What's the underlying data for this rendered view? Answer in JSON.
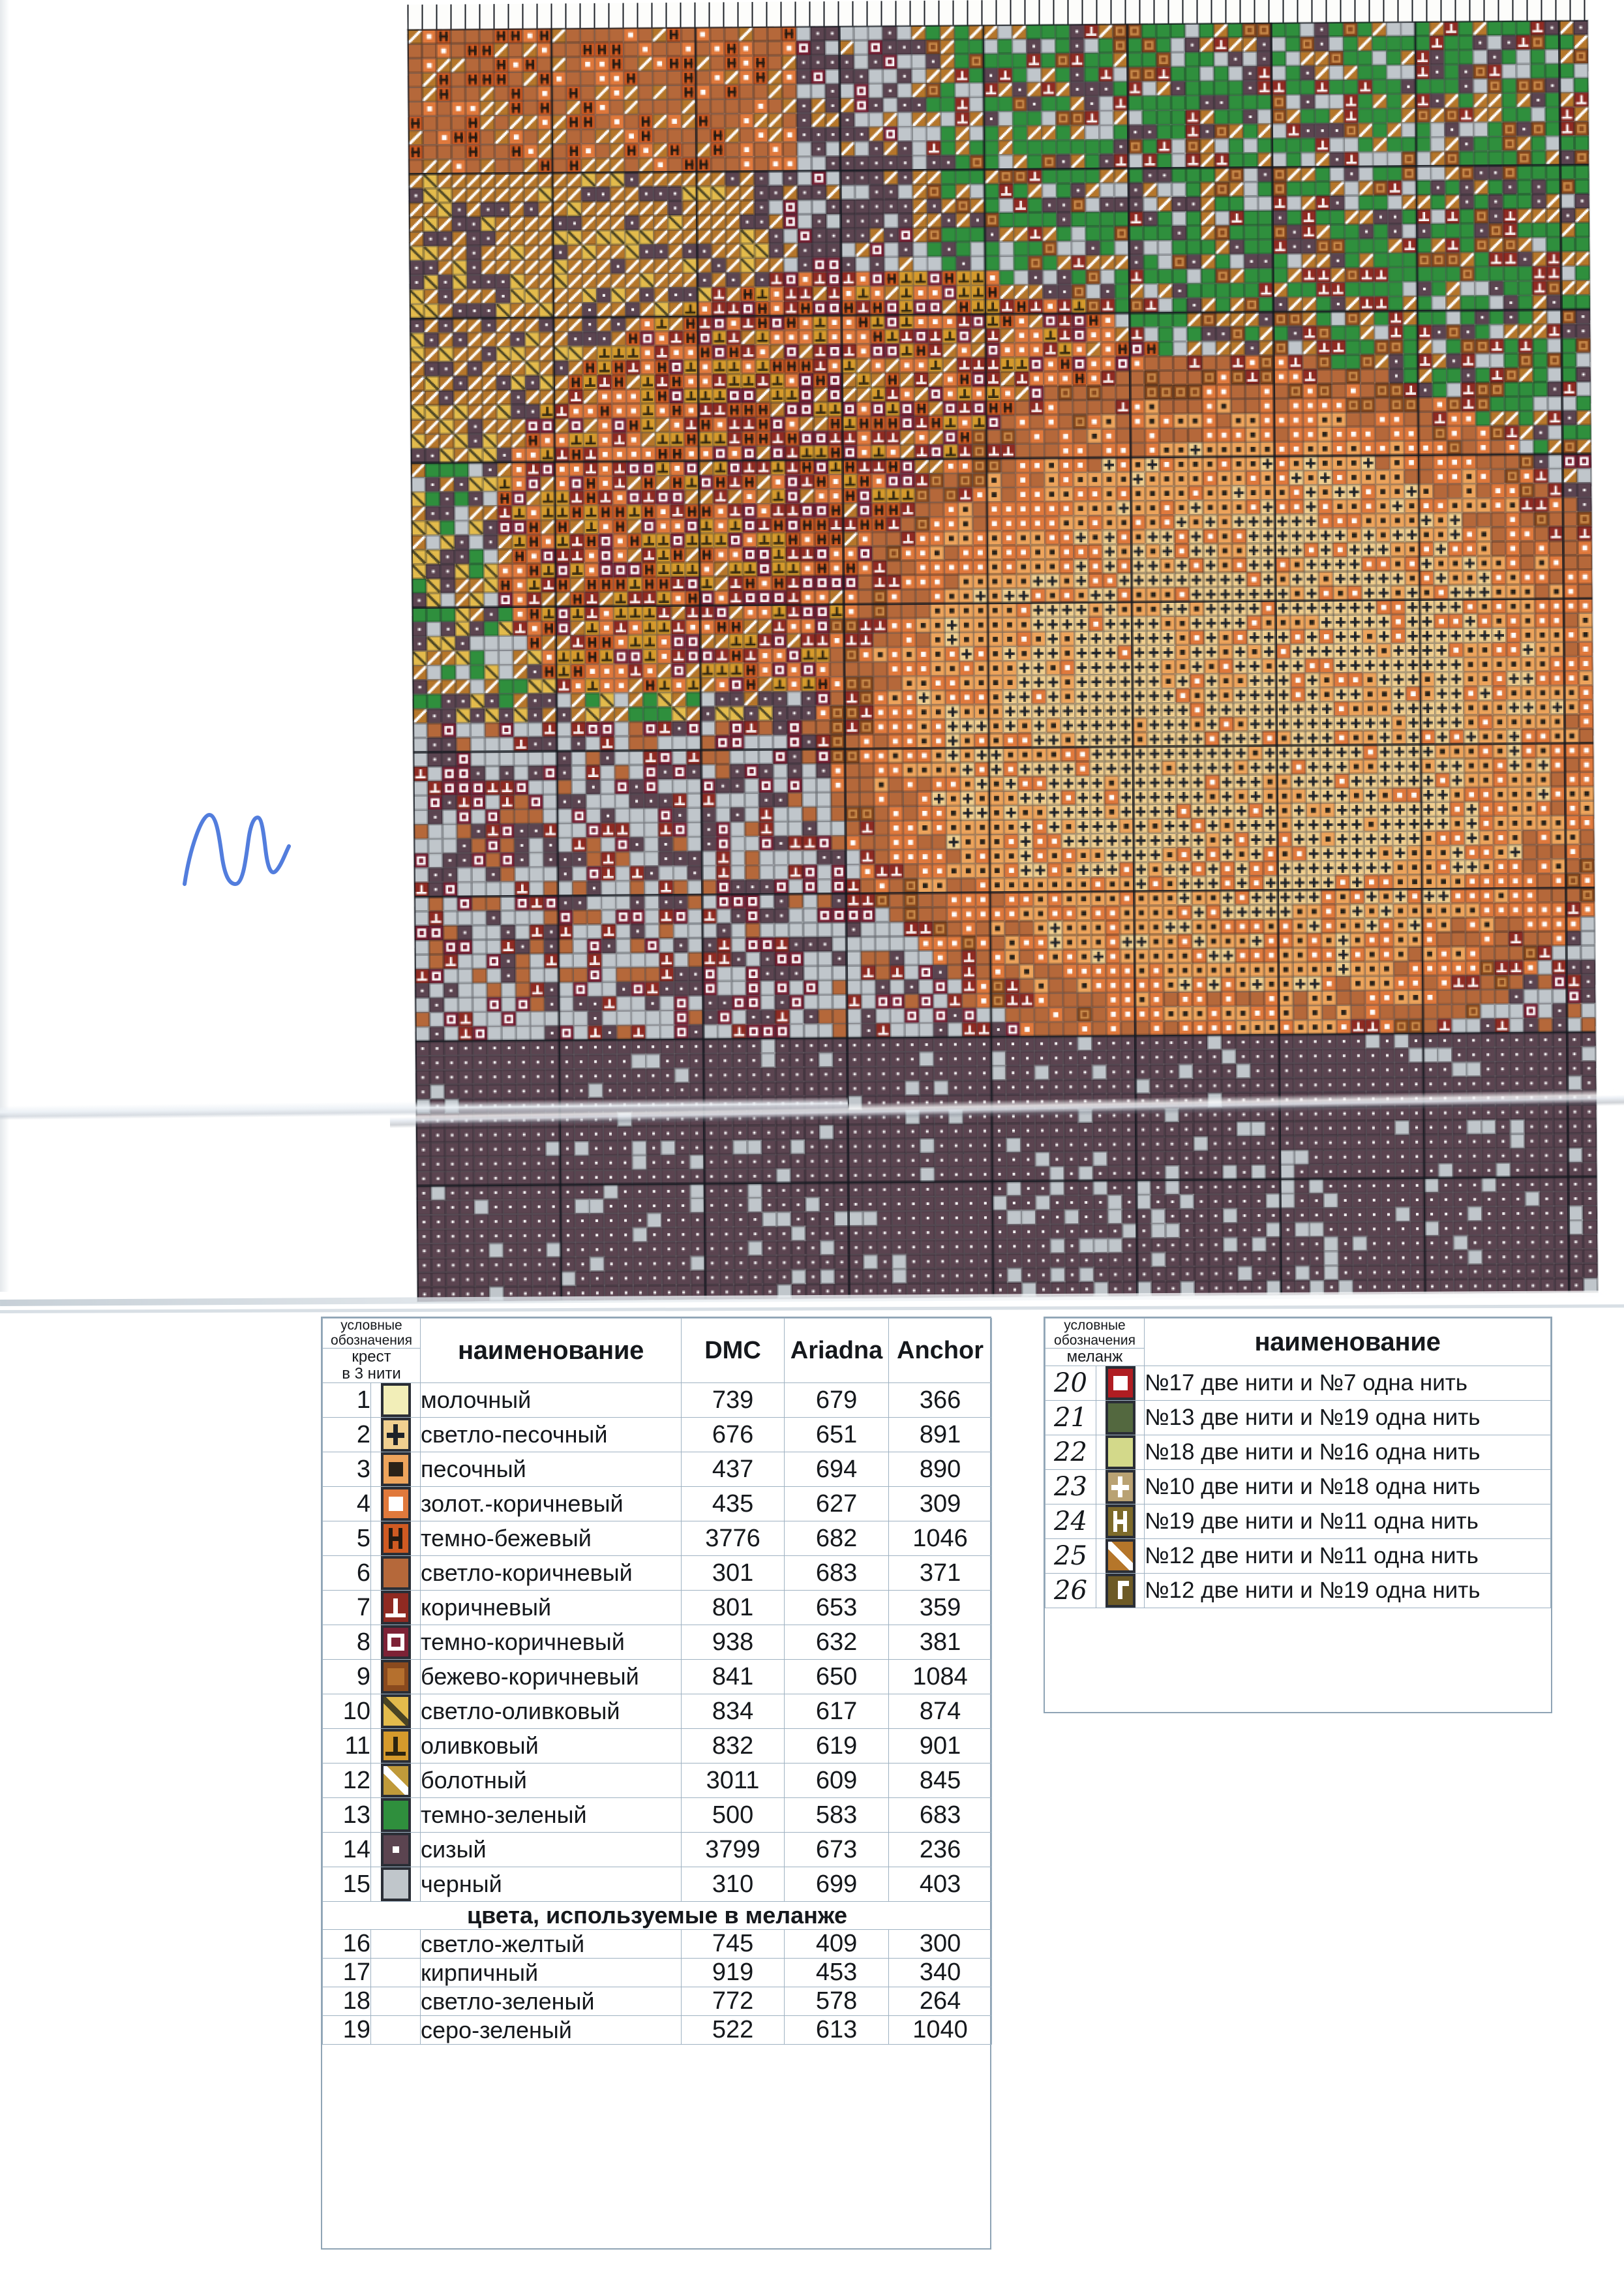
{
  "document": {
    "kind": "cross-stitch-pattern-sheet",
    "handwritten_mark": "M"
  },
  "chart_data": {
    "type": "heatmap",
    "title": "",
    "subtitle": "",
    "xlabel": "",
    "ylabel": "",
    "grid": true,
    "legend_position": "below",
    "description": "Counted cross-stitch chart: a tiger / big-cat head in orange-gold tones among green foliage on a grey-blue and plum background, rendered as a symbol grid.",
    "columns": 82,
    "rows": 88,
    "palette_keys": [
      1,
      2,
      3,
      4,
      5,
      6,
      7,
      8,
      9,
      10,
      11,
      12,
      13,
      14,
      15,
      20,
      21,
      22,
      23,
      24,
      25,
      26
    ],
    "region_fills": [
      {
        "region": "top-left-sky",
        "symbol": 14,
        "color": "#4a4f5c"
      },
      {
        "region": "upper-left-flame",
        "symbol": 6,
        "color": "#c4501d"
      },
      {
        "region": "upper-left-gold",
        "symbol": 25,
        "color": "#9c7a22"
      },
      {
        "region": "upper-right-foliage",
        "symbol": 13,
        "color": "#2f8f3d"
      },
      {
        "region": "center-mane",
        "symbol": 4,
        "color": "#e08a3c"
      },
      {
        "region": "center-face",
        "symbol": 2,
        "color": "#efc375"
      },
      {
        "region": "lower-band",
        "symbol": 15,
        "color": "#b8bfc6"
      },
      {
        "region": "bottom-ground",
        "symbol": 14,
        "color": "#5d4450"
      }
    ]
  },
  "legend_main": {
    "header": {
      "symbol_top": "условные\nобозначения",
      "symbol_top_line1": "условные",
      "symbol_top_line2": "обозначения",
      "symbol_bottom_line1": "крест",
      "symbol_bottom_line2": "в 3 нити",
      "name": "наименование",
      "dmc": "DMC",
      "ariadna": "Ariadna",
      "anchor": "Anchor"
    },
    "subheader": "цвета, используемые в меланже",
    "rows": [
      {
        "no": "1",
        "name": "молочный",
        "dmc": "739",
        "ariadna": "679",
        "anchor": "366",
        "fill": "#f2eeb8",
        "glyph": "none",
        "ink": "#1e2228"
      },
      {
        "no": "2",
        "name": "светло-песочный",
        "dmc": "676",
        "ariadna": "651",
        "anchor": "891",
        "fill": "#f0cf90",
        "glyph": "plus",
        "ink": "#1e2228"
      },
      {
        "no": "3",
        "name": "песочный",
        "dmc": "437",
        "ariadna": "694",
        "anchor": "890",
        "fill": "#eda45c",
        "glyph": "dot-lg",
        "ink": "#2a2218"
      },
      {
        "no": "4",
        "name": "золот.-коричневый",
        "dmc": "435",
        "ariadna": "627",
        "anchor": "309",
        "fill": "#e0793c",
        "glyph": "dot-lg",
        "ink": "#ffffff"
      },
      {
        "no": "5",
        "name": "темно-бежевый",
        "dmc": "3776",
        "ariadna": "682",
        "anchor": "1046",
        "fill": "#cf5a22",
        "glyph": "H",
        "ink": "#241a12"
      },
      {
        "no": "6",
        "name": "светло-коричневый",
        "dmc": "301",
        "ariadna": "683",
        "anchor": "371",
        "fill": "#b5683a",
        "glyph": "none",
        "ink": "#241a12"
      },
      {
        "no": "7",
        "name": "коричневый",
        "dmc": "801",
        "ariadna": "653",
        "anchor": "359",
        "fill": "#8f2a22",
        "glyph": "tee",
        "ink": "#ffffff"
      },
      {
        "no": "8",
        "name": "темно-коричневый",
        "dmc": "938",
        "ariadna": "632",
        "anchor": "381",
        "fill": "#7d2236",
        "glyph": "ring",
        "ink": "#ffffff"
      },
      {
        "no": "9",
        "name": "бежево-коричневый",
        "dmc": "841",
        "ariadna": "650",
        "anchor": "1084",
        "fill": "#8a4a1e",
        "glyph": "ringbrn",
        "ink": "#c98a4a"
      },
      {
        "no": "10",
        "name": "светло-оливковый",
        "dmc": "834",
        "ariadna": "617",
        "anchor": "874",
        "fill": "#e3bb4c",
        "glyph": "slash-d",
        "ink": "#3a3620"
      },
      {
        "no": "11",
        "name": "оливковый",
        "dmc": "832",
        "ariadna": "619",
        "anchor": "901",
        "fill": "#d59a2c",
        "glyph": "tee",
        "ink": "#2c2410"
      },
      {
        "no": "12",
        "name": "болотный",
        "dmc": "3011",
        "ariadna": "609",
        "anchor": "845",
        "fill": "#c09a3a",
        "glyph": "slash-w",
        "ink": "#ffffff"
      },
      {
        "no": "13",
        "name": "темно-зеленый",
        "dmc": "500",
        "ariadna": "583",
        "anchor": "683",
        "fill": "#2f8f3d",
        "glyph": "none",
        "ink": "#ffffff"
      },
      {
        "no": "14",
        "name": "сизый",
        "dmc": "3799",
        "ariadna": "673",
        "anchor": "236",
        "fill": "#5b4450",
        "glyph": "dot-sm",
        "ink": "#ffffff"
      },
      {
        "no": "15",
        "name": "черный",
        "dmc": "310",
        "ariadna": "699",
        "anchor": "403",
        "fill": "#c0c6cb",
        "glyph": "none",
        "ink": "#2a2e36"
      }
    ],
    "melange_source_rows": [
      {
        "no": "16",
        "name": "светло-желтый",
        "dmc": "745",
        "ariadna": "409",
        "anchor": "300"
      },
      {
        "no": "17",
        "name": "кирпичный",
        "dmc": "919",
        "ariadna": "453",
        "anchor": "340"
      },
      {
        "no": "18",
        "name": "светло-зеленый",
        "dmc": "772",
        "ariadna": "578",
        "anchor": "264"
      },
      {
        "no": "19",
        "name": "серо-зеленый",
        "dmc": "522",
        "ariadna": "613",
        "anchor": "1040"
      }
    ]
  },
  "legend_melange": {
    "header": {
      "symbol_top_line1": "условные",
      "symbol_top_line2": "обозначения",
      "symbol_bottom": "меланж",
      "name": "наименование"
    },
    "rows": [
      {
        "no": "20",
        "name": "№17 две нити и №7 одна нить",
        "fill": "#b01d22",
        "glyph": "dot-lg",
        "ink": "#ffffff"
      },
      {
        "no": "21",
        "name": "№13 две нити и №19 одна нить",
        "fill": "#53683f",
        "glyph": "none",
        "ink": "#ffffff"
      },
      {
        "no": "22",
        "name": "№18 две нити и №16 одна нить",
        "fill": "#d3d98a",
        "glyph": "none",
        "ink": "#2a2e36"
      },
      {
        "no": "23",
        "name": "№10 две нити и №18 одна нить",
        "fill": "#b9a273",
        "glyph": "plus",
        "ink": "#ffffff"
      },
      {
        "no": "24",
        "name": "№19 две нити и №11 одна нить",
        "fill": "#7d6a2a",
        "glyph": "H",
        "ink": "#ffffff"
      },
      {
        "no": "25",
        "name": "№12 две нити и №11 одна нить",
        "fill": "#b5762a",
        "glyph": "slash-w",
        "ink": "#ffffff"
      },
      {
        "no": "26",
        "name": "№12 две нити и №19 одна нить",
        "fill": "#6d5a26",
        "glyph": "corner",
        "ink": "#ffffff"
      }
    ]
  }
}
